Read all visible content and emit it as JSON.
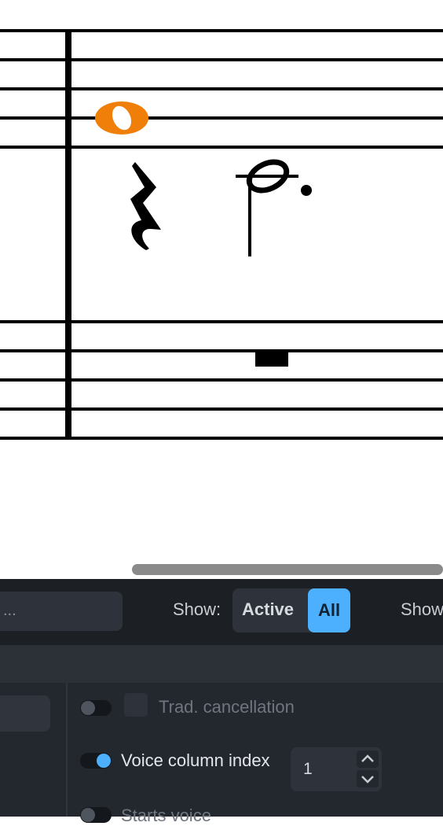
{
  "toolbar": {
    "search_placeholder": "...",
    "show_label": "Show:",
    "filter_active": "Active",
    "filter_all": "All",
    "show_label_2": "Show"
  },
  "properties": {
    "trad_cancellation": {
      "label": "Trad. cancellation",
      "enabled": false
    },
    "voice_column_index": {
      "label": "Voice column index",
      "enabled": true,
      "value": "1"
    },
    "starts_voice": {
      "label": "Starts voice",
      "enabled": false
    }
  },
  "colors": {
    "selected_note": "#f07f0a",
    "accent": "#4db0ff"
  }
}
